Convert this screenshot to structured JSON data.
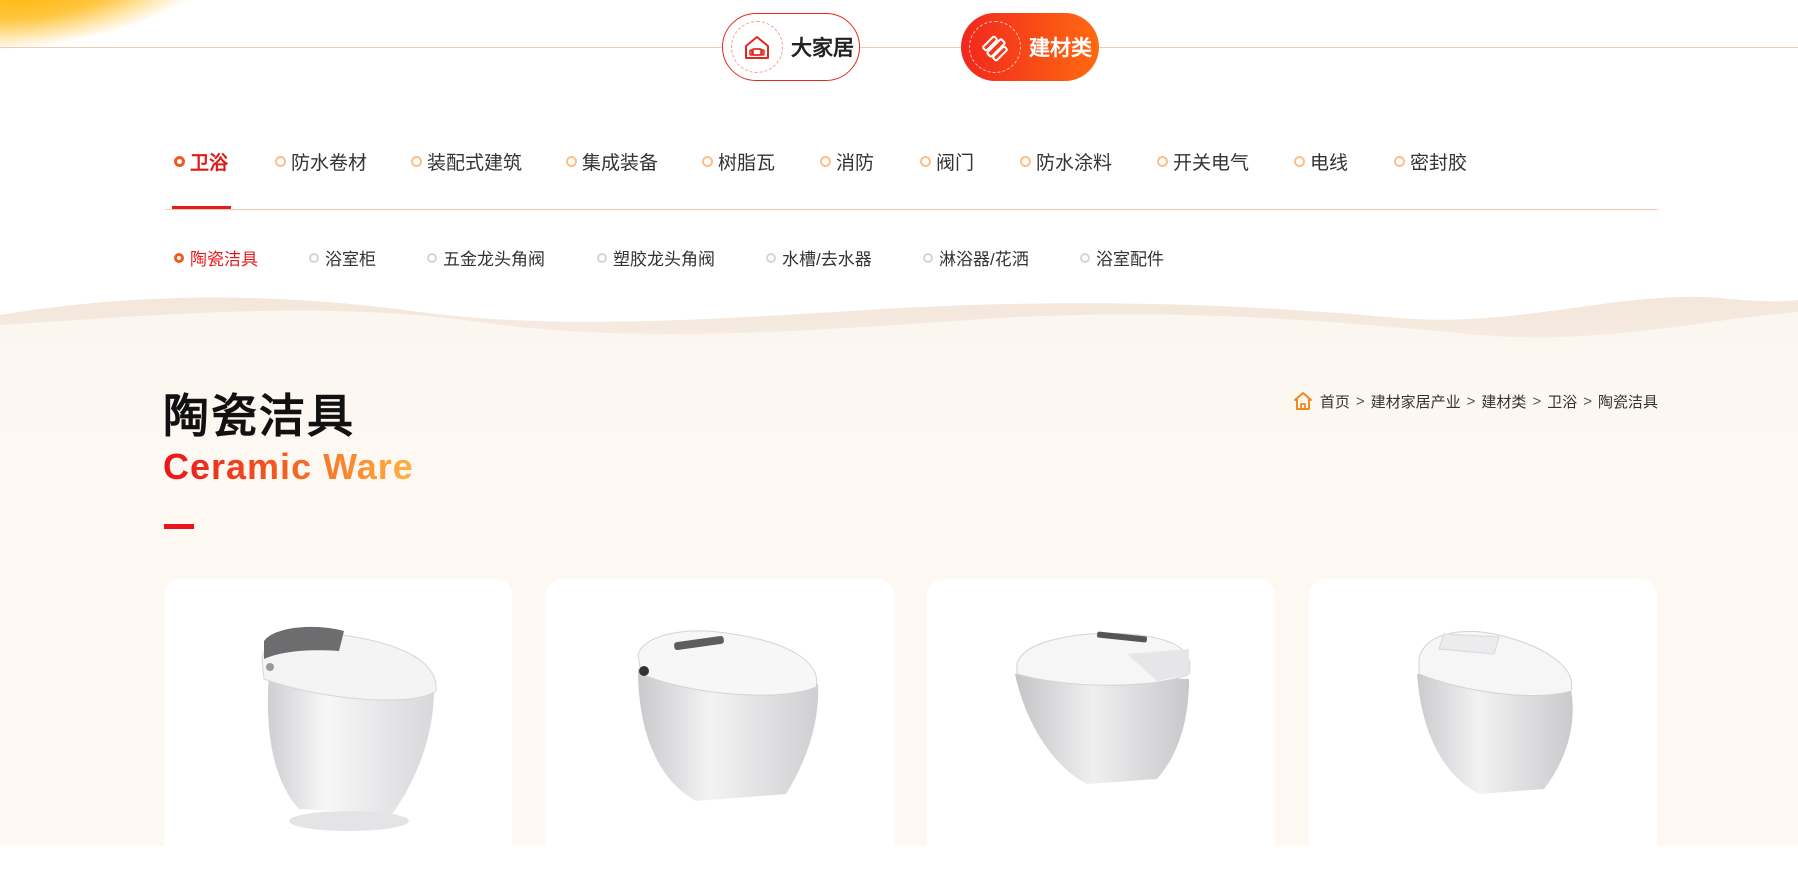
{
  "top_switch": {
    "home_label": "大家居",
    "build_label": "建材类",
    "active": "建材类"
  },
  "category_nav": {
    "items": [
      {
        "label": "卫浴",
        "active": true
      },
      {
        "label": "防水卷材",
        "active": false
      },
      {
        "label": "装配式建筑",
        "active": false
      },
      {
        "label": "集成装备",
        "active": false
      },
      {
        "label": "树脂瓦",
        "active": false
      },
      {
        "label": "消防",
        "active": false
      },
      {
        "label": "阀门",
        "active": false
      },
      {
        "label": "防水涂料",
        "active": false
      },
      {
        "label": "开关电气",
        "active": false
      },
      {
        "label": "电线",
        "active": false
      },
      {
        "label": "密封胶",
        "active": false
      }
    ]
  },
  "sub_nav": {
    "items": [
      {
        "label": "陶瓷洁具",
        "active": true
      },
      {
        "label": "浴室柜",
        "active": false
      },
      {
        "label": "五金龙头角阀",
        "active": false
      },
      {
        "label": "塑胶龙头角阀",
        "active": false
      },
      {
        "label": "水槽/去水器",
        "active": false
      },
      {
        "label": "淋浴器/花洒",
        "active": false
      },
      {
        "label": "浴室配件",
        "active": false
      }
    ]
  },
  "heading": {
    "title": "陶瓷洁具",
    "subtitle": "Ceramic Ware"
  },
  "breadcrumb": {
    "items": [
      "首页",
      "建材家居产业",
      "建材类",
      "卫浴",
      "陶瓷洁具"
    ],
    "separator": ">"
  },
  "products": [
    {
      "image": "smart-toilet-gray-lid"
    },
    {
      "image": "smart-toilet-white-panel"
    },
    {
      "image": "smart-toilet-wide-base"
    },
    {
      "image": "smart-toilet-compact"
    }
  ],
  "colors": {
    "accent_red": "#e41c1c",
    "accent_orange": "#ff6a10",
    "background_cream": "#fdf7f2"
  }
}
